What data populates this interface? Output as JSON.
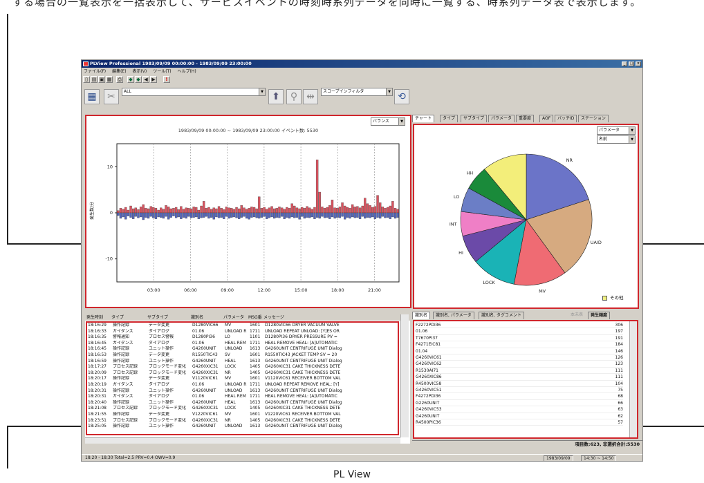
{
  "top_caption": "する場合の一覧表示を一括表示して、サービスイベントの時刻時系列データを同時に一覧する、時系列データ表で表示します。",
  "bottom_caption": "PL View",
  "window": {
    "title": "PLView Professional 1983/09/09 00:00:00 - 1983/09/09 23:00:00",
    "controls": [
      "_",
      "□",
      "×"
    ]
  },
  "menu": [
    "ファイル(F)",
    "編集(E)",
    "表示(V)",
    "ツール(T)",
    "ヘルプ(H)"
  ],
  "toolbar2": {
    "filter_value": "ALL",
    "scope_filter": "スコープインフィルタ"
  },
  "chart_panel": {
    "title": "1983/09/09 00:00:00 ~ 1983/09/09 23:00:00 イベント数: 5530",
    "mode": "バランス"
  },
  "chart_data": {
    "type": "bar",
    "ylabel": "発生数/分",
    "ylim": [
      -15,
      15
    ],
    "yticks": [
      10,
      0,
      -10
    ],
    "xticks": [
      "03:00",
      "06:00",
      "09:00",
      "12:00",
      "15:00",
      "18:00",
      "21:00"
    ],
    "xrange_hours": [
      0,
      23
    ],
    "series": [
      {
        "color": "#d9535f",
        "values": [
          0.5,
          1,
          0.8,
          1.2,
          0.6,
          1.5,
          0.9,
          1.1,
          0.7,
          1.3,
          1.8,
          1.0,
          0.9,
          1.4,
          1.2,
          1.0,
          0.6,
          1.1,
          0.8,
          1.6,
          1.3,
          0.9,
          1.0,
          1.2,
          0.7,
          1.4,
          0.8,
          1.1,
          1.0,
          0.9,
          1.3,
          1.2,
          0.6,
          1.5,
          2.5,
          1.0,
          1.2,
          0.8,
          1.1,
          0.9,
          1.4,
          1.0,
          0.7,
          1.3,
          1.1,
          1.0,
          0.8,
          1.2,
          0.9,
          1.6,
          1.1,
          0.8,
          1.0,
          1.3,
          1.2,
          0.9,
          3.5,
          1.0,
          1.2,
          0.8,
          1.1,
          1.4,
          0.9,
          1.0,
          1.3,
          1.1,
          0.8,
          1.2,
          1.0,
          2.0,
          1.5,
          1.1,
          0.9,
          1.2,
          1.0,
          1.4,
          1.1,
          0.8,
          1.2,
          11.5,
          4.5,
          1.3,
          1.0,
          1.2,
          1.6,
          2.8,
          1.1,
          1.0,
          1.3,
          2.2,
          1.5,
          1.2,
          1.0,
          1.8,
          1.3,
          1.4,
          1.1,
          1.5,
          3.2,
          2.0,
          1.6,
          1.2,
          1.4,
          3.8,
          2.2,
          1.3,
          1.0,
          1.2,
          1.5,
          2.5,
          1.0,
          0.8
        ]
      },
      {
        "color": "#5566bb",
        "values": [
          -0.6,
          -1.2,
          -0.9,
          -1.4,
          -0.7,
          -1.0,
          -1.3,
          -0.8,
          -1.1,
          -0.9,
          -1.5,
          -1.0,
          -1.2,
          -0.8,
          -1.1,
          -1.3,
          -0.9,
          -1.0,
          -1.2,
          -0.8,
          -1.4,
          -1.0,
          -0.7,
          -1.1,
          -0.9,
          -1.3,
          -1.0,
          -1.2,
          -0.8,
          -1.1,
          -1.0,
          -0.9,
          -1.3,
          -1.1,
          -1.0,
          -0.8,
          -1.2,
          -1.0,
          -1.4,
          -0.9,
          -1.1,
          -1.0,
          -1.3,
          -0.8,
          -1.2,
          -1.0,
          -0.9,
          -1.1,
          -1.3,
          -1.0,
          -0.8,
          -1.2,
          -1.4,
          -1.0,
          -0.9,
          -1.1,
          -1.2,
          -1.0,
          -0.8,
          -1.3,
          -1.1,
          -0.9,
          -1.2,
          -1.0,
          -1.1,
          -0.8,
          -1.3,
          -1.0,
          -1.2,
          -0.9,
          -1.1,
          -1.0,
          -1.4,
          -0.8,
          -1.2,
          -1.0,
          -1.1,
          -0.9,
          -1.3,
          -1.0,
          -1.2,
          -0.8,
          -1.1,
          -1.0,
          -1.3,
          -0.9,
          -1.2,
          -1.0,
          -1.1,
          -0.8,
          -1.4,
          -1.0,
          -1.2,
          -0.9,
          -1.1,
          -1.0,
          -1.3,
          -0.8,
          -1.2,
          -1.0,
          -1.1,
          -0.9,
          -1.3,
          -1.0,
          -1.2,
          -0.8,
          -1.1,
          -1.0,
          -1.3,
          -0.9,
          -1.2,
          -1.0
        ]
      }
    ]
  },
  "right_tabs": [
    "チャート",
    "タイプ",
    "サブタイプ",
    "パラメータ",
    "重要度",
    "AOF",
    "バッチID",
    "ステーション"
  ],
  "pie_panel": {
    "group_by": "パラメータ",
    "sort_by": "名前",
    "legend_other": "その他"
  },
  "pie_data": {
    "type": "pie",
    "slices": [
      {
        "label": "NR",
        "value": 20,
        "color": "#6b74c8"
      },
      {
        "label": "UAID",
        "value": 20,
        "color": "#d6aa80"
      },
      {
        "label": "MV",
        "value": 13,
        "color": "#ef6b73"
      },
      {
        "label": "LOCK",
        "value": 11,
        "color": "#1ab3b6"
      },
      {
        "label": "HI",
        "value": 7,
        "color": "#6b4aa8"
      },
      {
        "label": "INT",
        "value": 6,
        "color": "#ef7fc6"
      },
      {
        "label": "LO",
        "value": 6,
        "color": "#6b7ec6"
      },
      {
        "label": "HH",
        "value": 6,
        "color": "#1a8a3a"
      },
      {
        "label": "",
        "value": 11,
        "color": "#f3ee7a"
      }
    ]
  },
  "event_table": {
    "headers": [
      "発生時刻",
      "タイプ",
      "サブタイプ",
      "識別名",
      "パラメータ",
      "MSG番",
      "メッセージ"
    ],
    "rows": [
      [
        "18:16:29",
        "操作記録",
        "データ変更",
        "D1280VIC66",
        "MV",
        "1601",
        "D1280VIC66 DRYER VACUUM VALVE"
      ],
      [
        "18:16:33",
        "ガイダンス",
        "ダイアログ",
        "01.06",
        "UNLOAD R",
        "1711",
        "UNLOAD REPEAT UNLOAD: [Y]ES OR"
      ],
      [
        "18:16:35",
        "警報通知",
        "プロセス警報",
        "D1280PI36",
        "LO",
        "1101",
        "D1280PI36 DRYER PRESSURE PV ="
      ],
      [
        "18:16:45",
        "ガイダンス",
        "ダイアログ",
        "01.06",
        "HEAL REM",
        "1711",
        "HEAL REMOVE HEAL: [A]UTOMATIC"
      ],
      [
        "18:16:45",
        "操作記録",
        "ユニット操作",
        "G4260UNIT",
        "UNLOAD",
        "1613",
        "G4260UNIT CENTRIFUGE UNIT Dialog"
      ],
      [
        "18:16:53",
        "操作記録",
        "データ変更",
        "R1550TIC43",
        "SV",
        "1601",
        "R1550TIC43 JACKET TEMP SV = 20"
      ],
      [
        "18:16:59",
        "操作記録",
        "ユニット操作",
        "G4260UNIT",
        "HEAL",
        "1613",
        "G4260UNIT CENTRIFUGE UNIT Dialog"
      ],
      [
        "18:17:27",
        "プロセス記録",
        "ブロックモード変化",
        "G4260XIC31",
        "LOCK",
        "1405",
        "G4260XIC31 CAKE THICKNESS DETE"
      ],
      [
        "18:20:09",
        "プロセス記録",
        "ブロックモード変化",
        "G4260XIC31",
        "NR",
        "1405",
        "G4260XIC31 CAKE THICKNESS DETE"
      ],
      [
        "18:20:17",
        "操作記録",
        "データ変更",
        "V1120VIC61",
        "MV",
        "1601",
        "V1120VIC61 RECEIVER BOTTOM VAL"
      ],
      [
        "18:20:19",
        "ガイダンス",
        "ダイアログ",
        "01.06",
        "UNLOAD R",
        "1711",
        "UNLOAD REPEAT REMOVE HEAL: [Y]"
      ],
      [
        "18:20:31",
        "操作記録",
        "ユニット操作",
        "G4260UNIT",
        "UNLOAD",
        "1613",
        "G4260UNIT CENTRIFUGE UNIT Dialog"
      ],
      [
        "18:20:31",
        "ガイダンス",
        "ダイアログ",
        "01.06",
        "HEAL REM",
        "1711",
        "HEAL REMOVE HEAL: [A]UTOMATIC"
      ],
      [
        "18:20:40",
        "操作記録",
        "ユニット操作",
        "G4260UNIT",
        "HEAL",
        "1613",
        "G4260UNIT CENTRIFUGE UNIT Dialog"
      ],
      [
        "18:21:08",
        "プロセス記録",
        "ブロックモード変化",
        "G4260XIC31",
        "LOCK",
        "1405",
        "G4260XIC31 CAKE THICKNESS DETE"
      ],
      [
        "18:21:55",
        "操作記録",
        "データ変更",
        "V1220VIC61",
        "MV",
        "1601",
        "V1220VIC61 RECEIVER BOTTOM VAL"
      ],
      [
        "18:23:51",
        "プロセス記録",
        "ブロックモード変化",
        "G4260XIC31",
        "NR",
        "1405",
        "G4260XIC31 CAKE THICKNESS DETE"
      ],
      [
        "18:25:05",
        "操作記録",
        "ユニット操作",
        "G4260UNIT",
        "UNLOAD",
        "1613",
        "G4260UNIT CENTRIFUGE UNIT Dialog"
      ]
    ]
  },
  "tag_tabs": [
    "識別名",
    "識別名, パラメータ",
    "識別名, タグコメント"
  ],
  "tag_header": {
    "hint": "本未表",
    "sort": "発生頻度"
  },
  "tag_list": [
    [
      "F2272PDI36",
      "306"
    ],
    [
      "01.06",
      "197"
    ],
    [
      "T7670PI37",
      "191"
    ],
    [
      "F4271EIC81",
      "184"
    ],
    [
      "01.04",
      "146"
    ],
    [
      "G4260VIC61",
      "126"
    ],
    [
      "G4260VIC62",
      "123"
    ],
    [
      "R1530AI71",
      "111"
    ],
    [
      "G4260XIC86",
      "111"
    ],
    [
      "R4500VIC58",
      "104"
    ],
    [
      "G4260VIC51",
      "75"
    ],
    [
      "F4272PDI36",
      "68"
    ],
    [
      "G2260UNIT",
      "66"
    ],
    [
      "G4260VIC53",
      "63"
    ],
    [
      "G4260UNIT",
      "62"
    ],
    [
      "R4500PIC36",
      "57"
    ]
  ],
  "tag_footer": "項目数:623, 非選択合計:5530",
  "status": {
    "left": "18:20 - 18:30  Total=2.5  PRV=0.4  OWV=0.9",
    "date": "1983/09/09",
    "range": "14:30 ~ 14:50"
  }
}
